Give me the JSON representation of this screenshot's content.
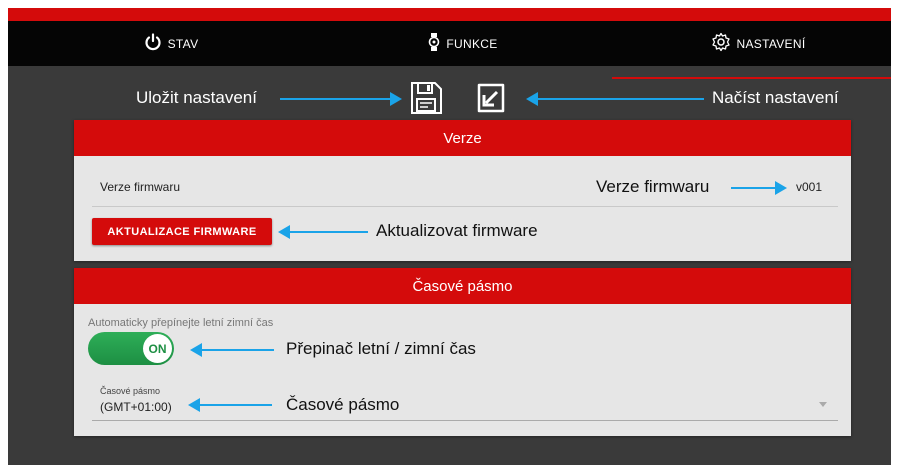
{
  "nav": {
    "tabs": [
      {
        "label": "STAV",
        "icon": "power-icon"
      },
      {
        "label": "FUNKCE",
        "icon": "watch-icon"
      },
      {
        "label": "NASTAVENÍ",
        "icon": "gear-icon",
        "active": true
      }
    ]
  },
  "toolbar": {
    "save_icon": "save-icon",
    "load_icon": "load-icon"
  },
  "annotations": {
    "save": "Uložit nastavení",
    "load": "Načíst nastavení",
    "firmware_version": "Verze firmwaru",
    "update_firmware": "Aktualizovat firmware",
    "dst_switch": "Přepinač letní / zimní čas",
    "timezone": "Časové pásmo"
  },
  "version_card": {
    "title": "Verze",
    "firmware_label": "Verze firmwaru",
    "firmware_value": "v001",
    "update_button": "AKTUALIZACE FIRMWARE"
  },
  "timezone_card": {
    "title": "Časové pásmo",
    "dst_label": "Automaticky přepínejte letní zimní čas",
    "dst_toggle": "ON",
    "timezone_label": "Časové pásmo",
    "timezone_value": "(GMT+01:00)"
  },
  "colors": {
    "accent": "#d40b0b",
    "arrow": "#1aa3e8",
    "toggle_on": "#1d8f43"
  }
}
